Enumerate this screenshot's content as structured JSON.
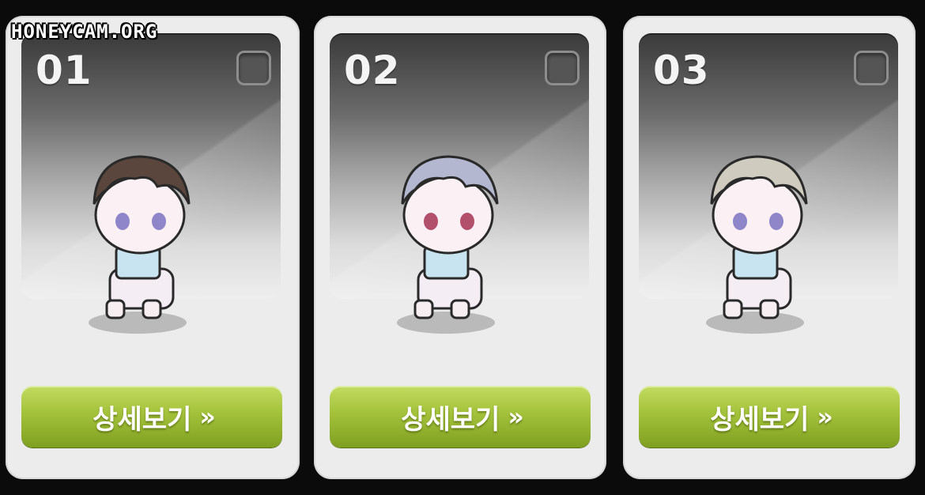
{
  "watermark": "HONEYCAM.ORG",
  "cards": [
    {
      "number": "01",
      "button_label": "상세보기",
      "button_icon": "double-chevron-right-icon",
      "hair_color": "#5a463c"
    },
    {
      "number": "02",
      "button_label": "상세보기",
      "button_icon": "double-chevron-right-icon",
      "hair_color": "#b3b7cf"
    },
    {
      "number": "03",
      "button_label": "상세보기",
      "button_icon": "double-chevron-right-icon",
      "hair_color": "#cfcbbf"
    }
  ],
  "colors": {
    "button_green": "#9bbb33",
    "card_background": "#ececec"
  }
}
